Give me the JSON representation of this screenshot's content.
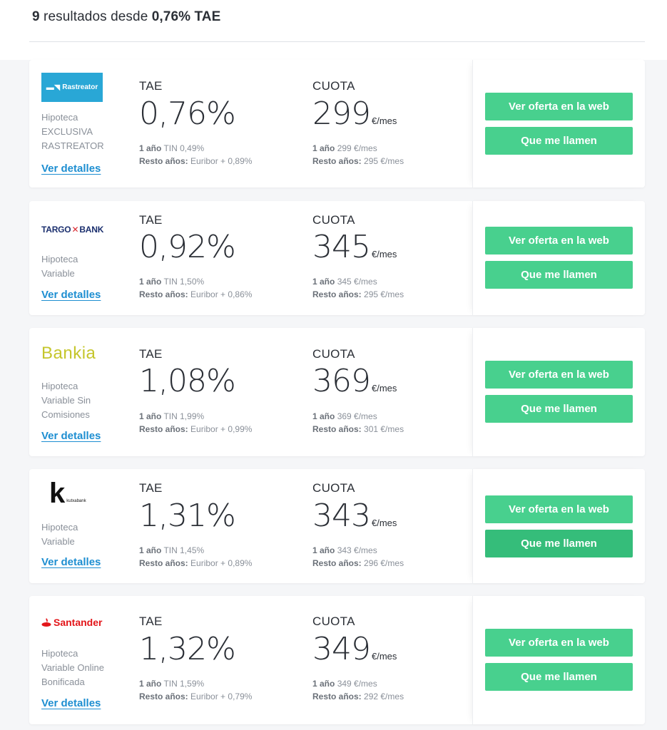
{
  "header": {
    "count": "9",
    "summary_text": " resultados desde ",
    "min_rate": "0,76% TAE"
  },
  "labels": {
    "tae": "TAE",
    "cuota": "CUOTA",
    "unit": "€/mes",
    "first_year": "1 año",
    "rest_years": "Resto años:",
    "details": "Ver detalles",
    "offer_button": "Ver oferta en la web",
    "call_button": "Que me llamen"
  },
  "offers": [
    {
      "bank": "Rastreator",
      "logo_text": "Rastreator",
      "product_lines": [
        "Hipoteca",
        "EXCLUSIVA",
        "RASTREATOR"
      ],
      "tae": "0,76%",
      "cuota": "299",
      "tin": "TIN 0,49%",
      "rest_rate": "Euribor + 0,89%",
      "cuota_first": "299 €/mes",
      "cuota_rest": "295 €/mes"
    },
    {
      "bank": "Targobank",
      "logo_text_a": "TARGO",
      "logo_text_b": "BANK",
      "product_lines": [
        "Hipoteca",
        "Variable"
      ],
      "tae": "0,92%",
      "cuota": "345",
      "tin": "TIN 1,50%",
      "rest_rate": "Euribor + 0,86%",
      "cuota_first": "345 €/mes",
      "cuota_rest": "295 €/mes"
    },
    {
      "bank": "Bankia",
      "logo_text": "Bankia",
      "product_lines": [
        "Hipoteca",
        "Variable Sin",
        "Comisiones"
      ],
      "tae": "1,08%",
      "cuota": "369",
      "tin": "TIN 1,99%",
      "rest_rate": "Euribor + 0,99%",
      "cuota_first": "369 €/mes",
      "cuota_rest": "301 €/mes"
    },
    {
      "bank": "Kutxabank",
      "logo_text": "kutxabank",
      "product_lines": [
        "Hipoteca",
        "Variable"
      ],
      "tae": "1,31%",
      "cuota": "343",
      "tin": "TIN 1,45%",
      "rest_rate": "Euribor + 0,89%",
      "cuota_first": "343 €/mes",
      "cuota_rest": "296 €/mes"
    },
    {
      "bank": "Santander",
      "logo_text": "Santander",
      "product_lines": [
        "Hipoteca",
        "Variable Online",
        "Bonificada"
      ],
      "tae": "1,32%",
      "cuota": "349",
      "tin": "TIN 1,59%",
      "rest_rate": "Euribor + 0,79%",
      "cuota_first": "349 €/mes",
      "cuota_rest": "292 €/mes"
    }
  ],
  "colors": {
    "accent_green": "#48d08e",
    "link_blue": "#1d8ed1",
    "rastreator_blue": "#29a7d6",
    "bankia_yellow": "#c5c62c",
    "santander_red": "#e3161a",
    "targo_navy": "#1b2f6e"
  }
}
